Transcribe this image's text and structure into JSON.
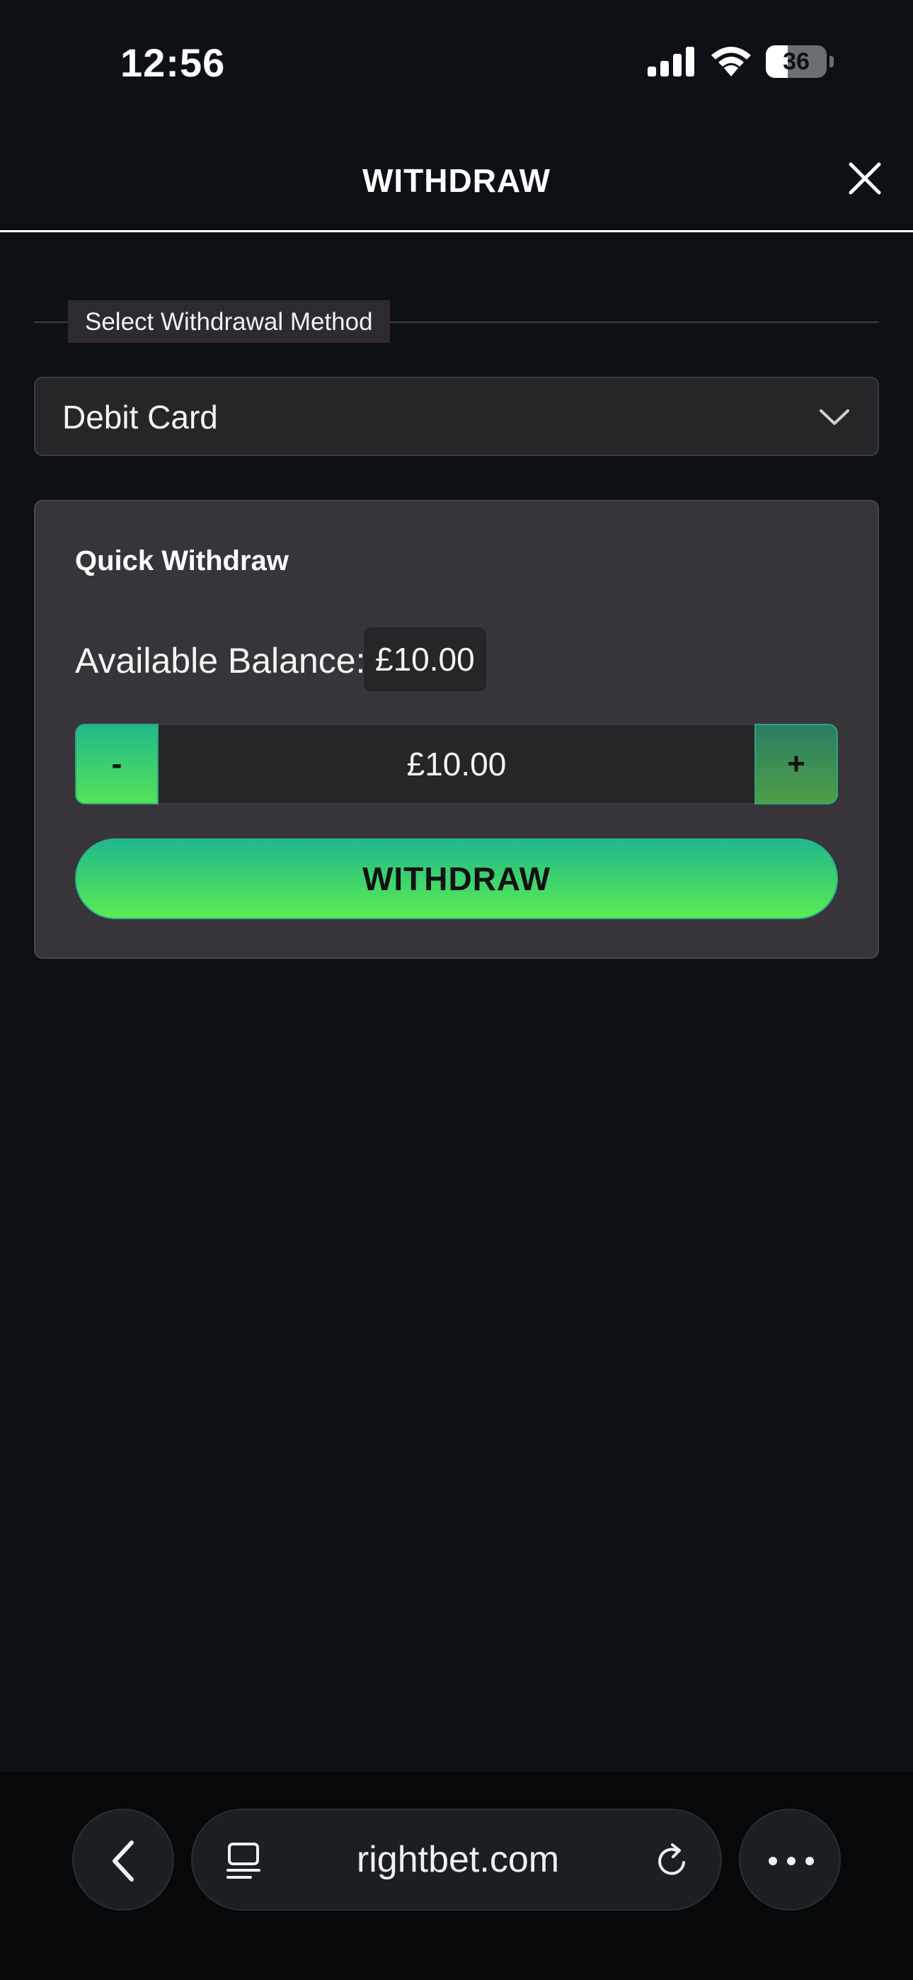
{
  "status_bar": {
    "time": "12:56",
    "battery": "36",
    "battery_level": 0.36
  },
  "header": {
    "title": "WITHDRAW",
    "close_icon": "close-icon"
  },
  "method": {
    "label": "Select Withdrawal Method",
    "selected": "Debit Card"
  },
  "quick_withdraw": {
    "title": "Quick Withdraw",
    "balance_label": "Available Balance:",
    "balance_value": "£10.00",
    "minus_label": "-",
    "plus_label": "+",
    "amount_value": "£10.00",
    "withdraw_label": "WITHDRAW"
  },
  "browser": {
    "url": "rightbet.com",
    "icons": [
      "chevron-left-icon",
      "tabs-icon",
      "reload-icon",
      "more-icon"
    ]
  },
  "colors": {
    "background": "#0d1115",
    "card": "#38353a",
    "accent_top": "#20b88c",
    "accent_bottom": "#5aec52"
  }
}
